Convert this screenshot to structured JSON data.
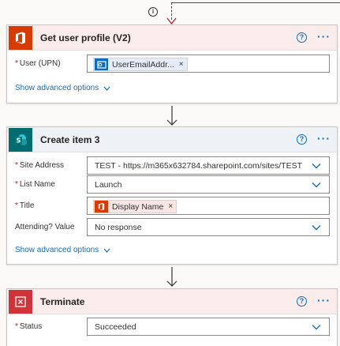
{
  "cards": [
    {
      "title": "Get user profile (V2)",
      "icon": "office-icon",
      "color": "#d83b01",
      "fields": [
        {
          "label": "User (UPN)",
          "required": true,
          "token": "UserEmailAddr...",
          "token_icon": "outlook-icon"
        }
      ],
      "advanced": "Show advanced options"
    },
    {
      "title": "Create item 3",
      "icon": "sharepoint-icon",
      "color": "#036c70",
      "fields": [
        {
          "label": "Site Address",
          "required": true,
          "value": "TEST - https://m365x632784.sharepoint.com/sites/TEST"
        },
        {
          "label": "List Name",
          "required": true,
          "value": "Launch"
        },
        {
          "label": "Title",
          "required": true,
          "token": "Display Name",
          "token_icon": "office-icon"
        },
        {
          "label": "Attending? Value",
          "required": false,
          "value": "No response"
        }
      ],
      "advanced": "Show advanced options"
    },
    {
      "title": "Terminate",
      "icon": "terminate-icon",
      "color": "#d13438",
      "fields": [
        {
          "label": "Status",
          "required": true,
          "value": "Succeeded"
        }
      ]
    }
  ],
  "help_glyph": "?",
  "more_glyph": "···",
  "info_glyph": "i",
  "remove_glyph": "×",
  "required_glyph": "*"
}
